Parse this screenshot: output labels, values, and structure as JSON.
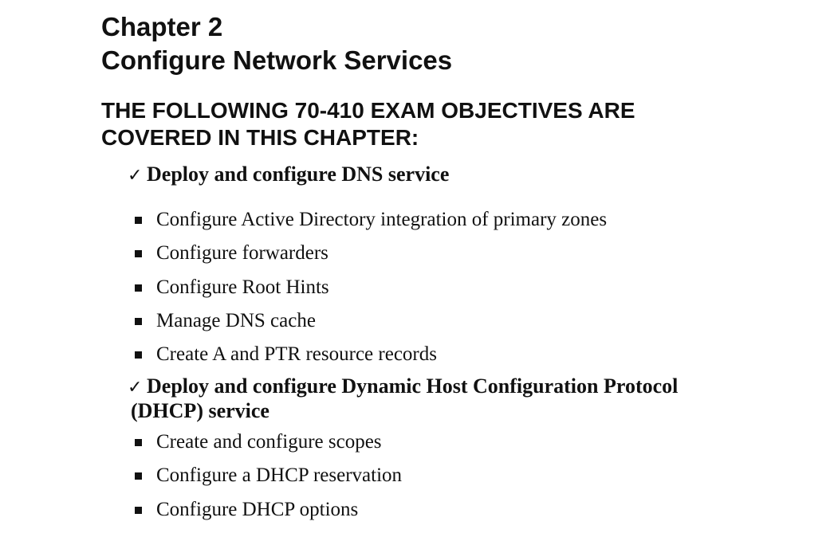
{
  "chapter": {
    "label": "Chapter 2",
    "title": "Configure Network Services"
  },
  "objectives_heading": "THE FOLLOWING 70-410 EXAM OBJECTIVES ARE COVERED IN THIS CHAPTER:",
  "objectives": [
    {
      "title": "Deploy and configure DNS service",
      "items": [
        "Configure Active Directory integration of primary zones",
        "Configure forwarders",
        "Configure Root Hints",
        "Manage DNS cache",
        "Create A and PTR resource records"
      ]
    },
    {
      "title": "Deploy and configure Dynamic Host Configuration Protocol (DHCP) service",
      "items": [
        "Create and configure scopes",
        "Configure a DHCP reservation",
        "Configure DHCP options"
      ]
    }
  ],
  "icons": {
    "objective_marker": "check-icon",
    "item_marker": "square-bullet-icon"
  },
  "colors": {
    "text": "#111111",
    "background": "#ffffff"
  }
}
